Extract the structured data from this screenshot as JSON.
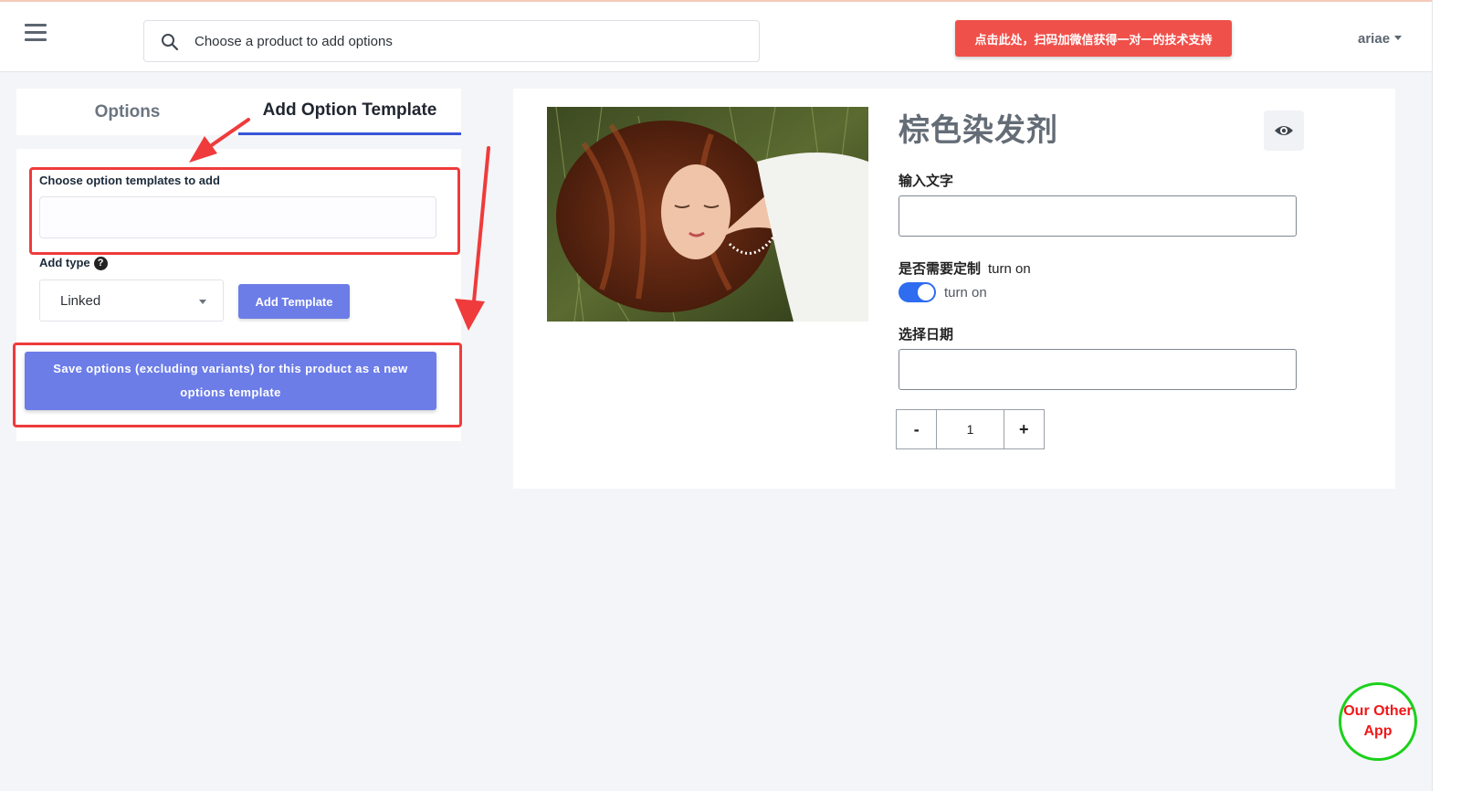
{
  "header": {
    "search_placeholder": "Choose a product to add options",
    "support_button": "点击此处，扫码加微信获得一对一的技术支持",
    "username": "ariae"
  },
  "tabs": [
    {
      "label": "Options",
      "active": false
    },
    {
      "label": "Add Option Template",
      "active": true
    }
  ],
  "template_form": {
    "choose_label": "Choose option templates to add",
    "choose_value": "",
    "add_type_label": "Add type",
    "help_icon_text": "?",
    "add_type_value": "Linked",
    "add_template_button": "Add Template",
    "save_button_line1": "Save options (excluding variants) for this product as a new",
    "save_button_line2": "options template"
  },
  "preview": {
    "product_title": "棕色染发剂",
    "text_field_label": "输入文字",
    "text_field_value": "",
    "custom_label": "是否需要定制",
    "custom_suffix": "turn on",
    "toggle_on": true,
    "toggle_text": "turn on",
    "date_label": "选择日期",
    "date_value": "",
    "quantity_minus": "-",
    "quantity_value": "1",
    "quantity_plus": "+"
  },
  "other_app": {
    "line1": "Our Other",
    "line2": "App"
  },
  "colors": {
    "accent_blue": "#6c7de8",
    "tab_underline": "#3a55d6",
    "support_red": "#f0504a",
    "annotation_red": "#ef3b3b",
    "toggle_blue": "#2e6cf0",
    "other_app_border": "#1bd11b"
  },
  "icons": [
    "hamburger-icon",
    "search-icon",
    "chevron-down-icon",
    "help-icon",
    "eye-icon"
  ]
}
